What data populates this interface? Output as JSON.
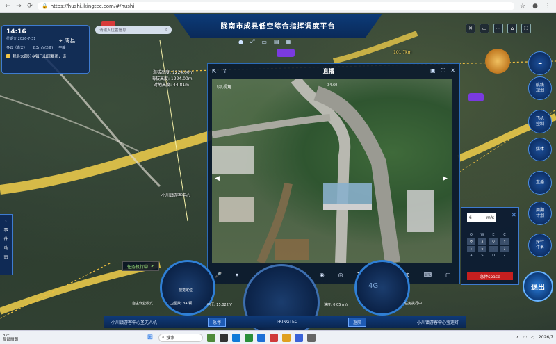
{
  "browser": {
    "url": "https://hushi.ikingtec.com/#/hushi"
  },
  "header": {
    "title": "陇南市成县低空综合指挥调度平台"
  },
  "info": {
    "time": "14:16",
    "date": "星期五 2026-7-31",
    "city": "成县",
    "weather": [
      "多云（白天）",
      "2.3m/s(2级)",
      "平静"
    ],
    "notice": "我县大部分乡镇已出现暴雨，请"
  },
  "search": {
    "placeholder": "请输入位置信息"
  },
  "map": {
    "labels": {
      "altitude": "海拔高度: 1224.00m",
      "elevation": "海拔高度: 1224.00m",
      "relative": "对地高度: 44.81m",
      "distance": "101.7km",
      "center_label": "小川镇游客中心"
    }
  },
  "live": {
    "title": "直播",
    "cam_label": "飞机视角",
    "heading": "34.60",
    "zoom": "1X"
  },
  "right_menu": [
    {
      "label": "航线\n规划"
    },
    {
      "label": "飞机\n控制"
    },
    {
      "label": "媒体"
    },
    {
      "label": "直播"
    },
    {
      "label": "周期\n计划"
    },
    {
      "label": "探针\n任务"
    }
  ],
  "left_tab": {
    "chars": [
      "事",
      "件",
      "动",
      "态"
    ]
  },
  "keyboard": {
    "speed_value": "6",
    "speed_unit": "m/s",
    "row1": [
      "Q",
      "W",
      "E",
      "C"
    ],
    "row3": [
      "A",
      "S",
      "D",
      "Z"
    ],
    "stop_label": "急停space"
  },
  "dashboard": {
    "task_status": "任务执行中",
    "mode": "自主作业模式",
    "satellites": "卫星数: 34 颗",
    "position": "视觉定位",
    "voltage": "电压: 15.022 V",
    "speed": "速度: 0.05 m/s",
    "right_status": "任务执行中",
    "left_name": "小川镇游客中心圣无人机",
    "right_name": "小川镇游客中心宝莲灯",
    "btn_left": "急停",
    "btn_right": "返航",
    "brand": "I·KINGTEC",
    "signal": "4G"
  },
  "exit": {
    "label": "退出"
  },
  "taskbar": {
    "temperature": "32°C",
    "weather_desc": "局部晴朗",
    "search_label": "搜索",
    "clock": "2026/7"
  },
  "colors": {
    "accent": "#2f7fd6",
    "road": "#e8c84a",
    "stop": "#c61f1f",
    "panel": "#0c285a"
  }
}
